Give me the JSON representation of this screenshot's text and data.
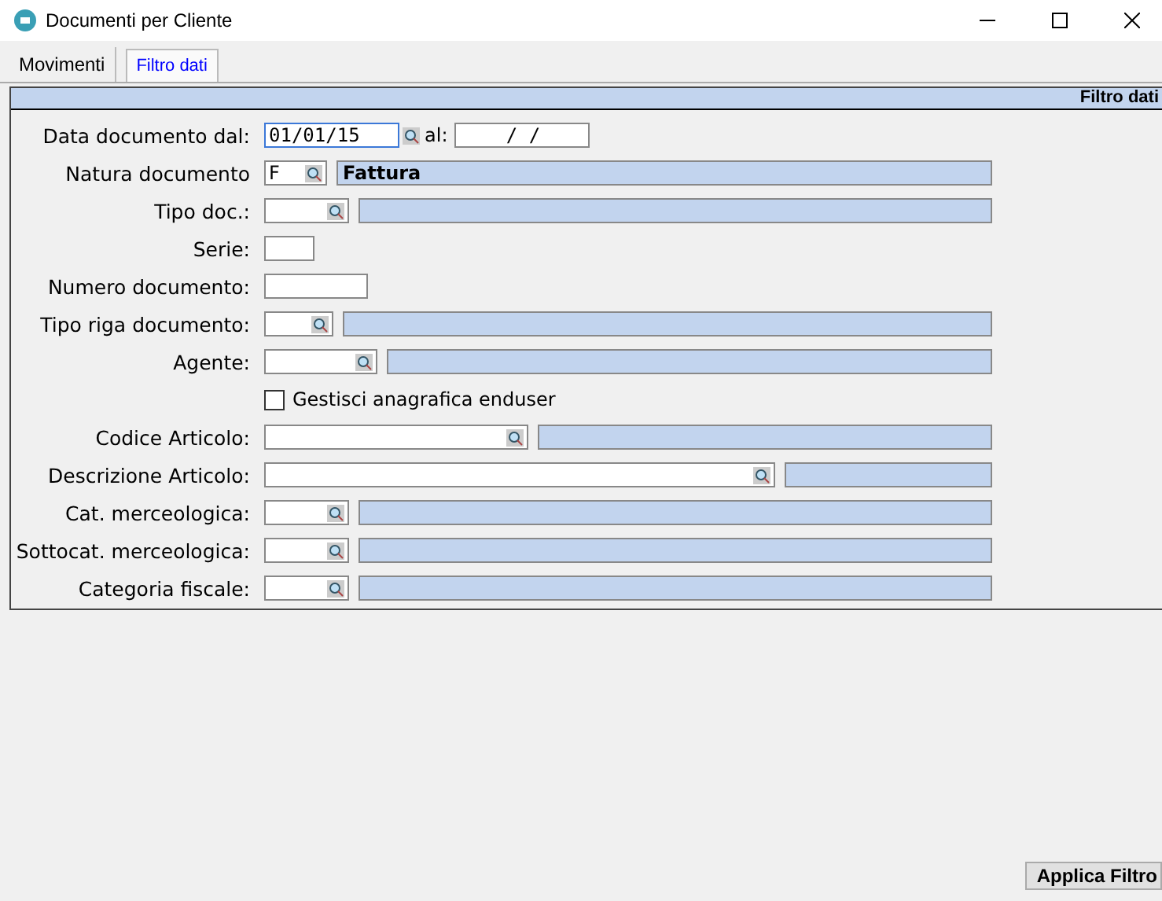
{
  "window": {
    "title": "Documenti per Cliente"
  },
  "tabs": [
    {
      "label": "Movimenti",
      "selected": false
    },
    {
      "label": "Filtro dati",
      "selected": true
    }
  ],
  "panel": {
    "header": "Filtro dati"
  },
  "rows": [
    {
      "kind": "date",
      "label": "Data documento dal:",
      "value": "01/01/15",
      "to_label": "al:",
      "to_value": "/   /"
    },
    {
      "kind": "lookup",
      "label": "Natura documento",
      "value": "F",
      "description": "Fattura"
    },
    {
      "kind": "lookup",
      "label": "Tipo doc.:"
    },
    {
      "kind": "text",
      "label": "Serie:"
    },
    {
      "kind": "text",
      "label": "Numero documento:"
    },
    {
      "kind": "lookup",
      "label": "Tipo riga documento:"
    },
    {
      "kind": "lookup",
      "label": "Agente:"
    },
    {
      "kind": "checkbox",
      "label": "Gestisci anagrafica enduser",
      "checked": false
    },
    {
      "kind": "lookup",
      "label": "Codice Articolo:"
    },
    {
      "kind": "lookup",
      "label": "Descrizione Articolo:"
    },
    {
      "kind": "lookup",
      "label": "Cat. merceologica:"
    },
    {
      "kind": "lookup",
      "label": "Sottocat. merceologica:"
    },
    {
      "kind": "lookup",
      "label": "Categoria fiscale:"
    }
  ],
  "apply_button": "Applica Filtro"
}
